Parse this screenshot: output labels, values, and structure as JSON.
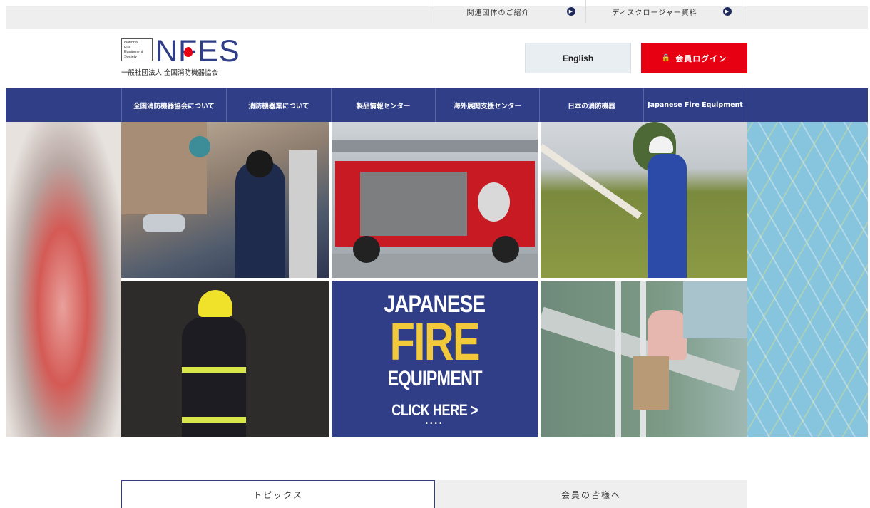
{
  "topbar": {
    "links": [
      {
        "label": "関連団体のご紹介",
        "icon": "arrow-right-circle-icon"
      },
      {
        "label": "ディスクロージャー資料",
        "icon": "arrow-right-circle-icon"
      }
    ]
  },
  "header": {
    "logo": {
      "box_lines": [
        "National",
        "Fire",
        "Equipment",
        "Society"
      ],
      "wordmark": "NFES",
      "subtitle": "一般社団法人 全国消防機器協会"
    },
    "english_button": "English",
    "login_button": "会員ログイン"
  },
  "nav": {
    "items": [
      "全国消防機器協会について",
      "消防機器業について",
      "製品情報センター",
      "海外展開支援センター",
      "日本の消防機器",
      "Japanese Fire Equipment"
    ]
  },
  "hero": {
    "banner": {
      "line1": "JAPANESE",
      "line2": "FIRE",
      "line3": "EQUIPMENT",
      "cta": "CLICK HERE >",
      "dots": "••••"
    }
  },
  "tabs": [
    "トピックス",
    "会員の皆様へ"
  ],
  "colors": {
    "brand_navy": "#2f3e86",
    "login_red": "#e60012",
    "banner_yellow": "#f2c93a"
  }
}
